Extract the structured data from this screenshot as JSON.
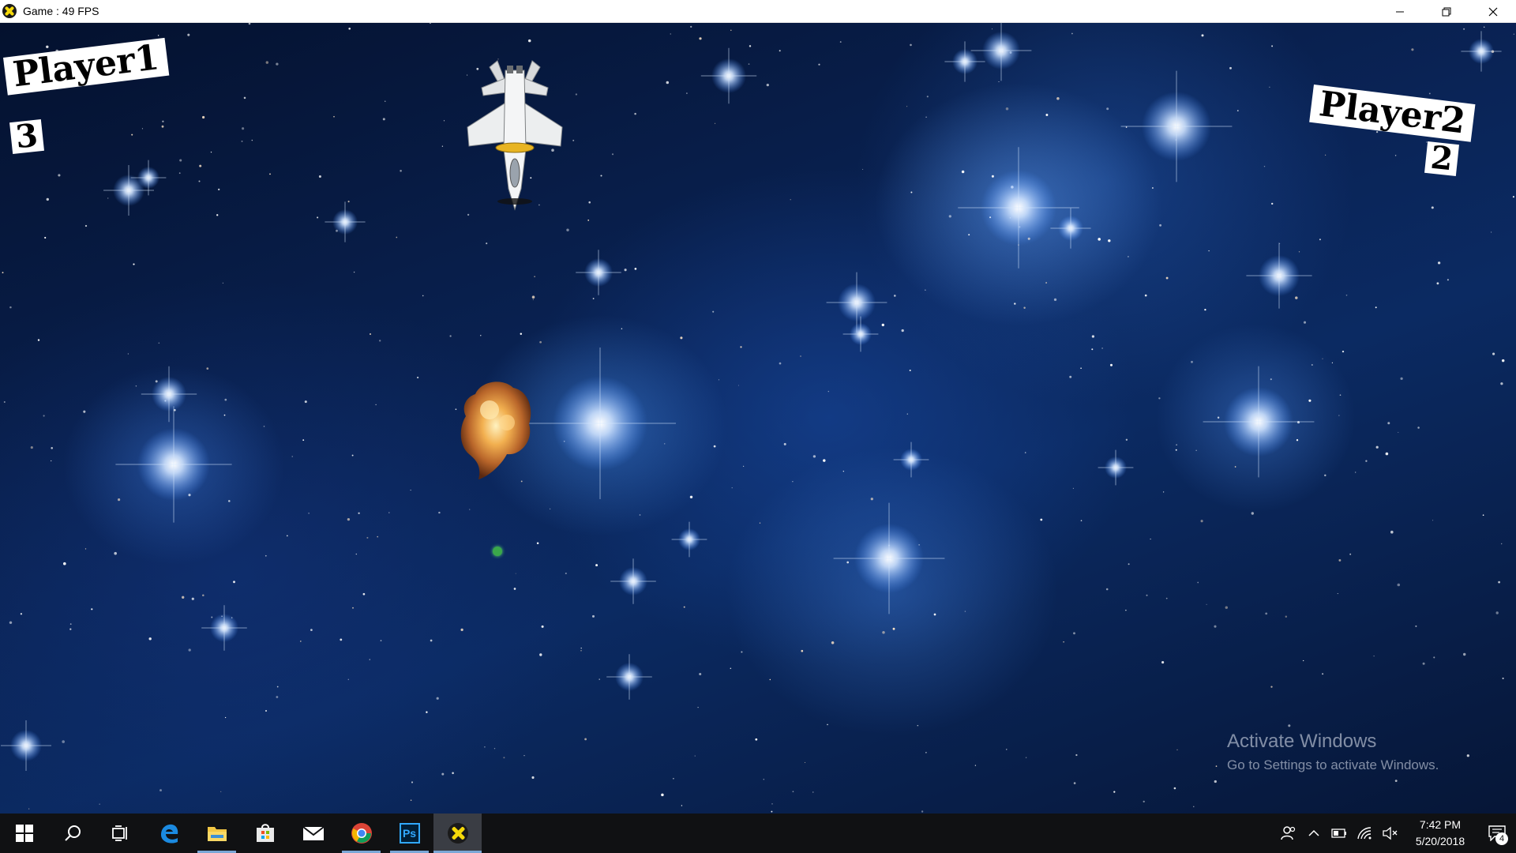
{
  "window": {
    "title": "Game : 49 FPS",
    "icon": "game-app-icon",
    "controls": [
      "minimize-icon",
      "restore-icon",
      "close-icon"
    ]
  },
  "game": {
    "player1": {
      "label": "Player1",
      "score": "3"
    },
    "player2": {
      "label": "Player2",
      "score": "2"
    },
    "sprites": [
      "fighter-jet",
      "explosion",
      "green-bullet"
    ],
    "background": "blue star cluster"
  },
  "watermark": {
    "title": "Activate Windows",
    "subtitle": "Go to Settings to activate Windows."
  },
  "taskbar": {
    "apps": [
      {
        "icon": "windows-start-icon"
      },
      {
        "icon": "search-icon"
      },
      {
        "icon": "task-view-icon"
      },
      {
        "icon": "edge-icon"
      },
      {
        "icon": "file-explorer-icon",
        "open": true
      },
      {
        "icon": "store-icon"
      },
      {
        "icon": "mail-icon"
      },
      {
        "icon": "chrome-icon",
        "open": true
      },
      {
        "icon": "photoshop-icon",
        "label": "Ps",
        "open": true
      },
      {
        "icon": "game-app-icon",
        "active": true
      }
    ],
    "tray": {
      "icons": [
        "people-icon",
        "chevron-up-icon",
        "battery-icon",
        "wifi-icon",
        "volume-muted-icon"
      ],
      "time": "7:42 PM",
      "date": "5/20/2018",
      "notification_count": "4"
    }
  },
  "colors": {
    "taskbar_bg": "#101113",
    "active_indicator": "#7aa7d6",
    "photoshop_bg": "#001e36",
    "photoshop_fg": "#31a8ff"
  }
}
